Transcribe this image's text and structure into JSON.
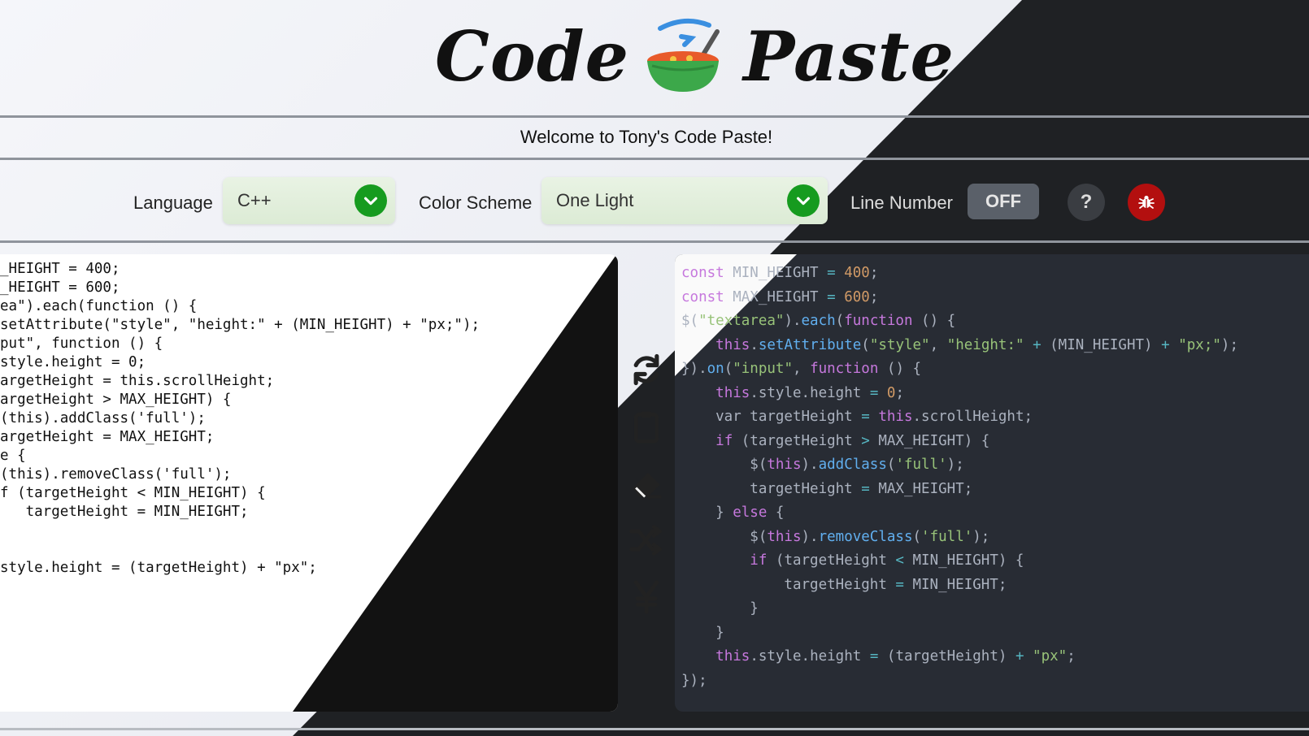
{
  "header": {
    "logo_left": "Code",
    "logo_right": "Paste",
    "welcome": "Welcome to Tony's Code Paste!"
  },
  "controls": {
    "language_label": "Language",
    "language_value": "C++",
    "scheme_label": "Color Scheme",
    "scheme_value": "One Light",
    "line_number_label": "Line Number",
    "line_number_state": "OFF",
    "help_label": "?"
  },
  "icons": [
    "bowl-logo-icon",
    "refresh-icon",
    "clipboard-icon",
    "eraser-icon",
    "shuffle-icon",
    "yen-icon",
    "chevron-down-icon",
    "bug-icon"
  ],
  "colors": {
    "dark_bg": "#1f2124",
    "code_bg": "#282c34",
    "accent_green": "#169b1f",
    "danger_red": "#b30f0f"
  },
  "code_left": [
    "_HEIGHT = 400;",
    "_HEIGHT = 600;",
    "ea\").each(function () {",
    "setAttribute(\"style\", \"height:\" + (MIN_HEIGHT) + \"px;\");",
    "put\", function () {",
    "style.height = 0;",
    "argetHeight = this.scrollHeight;",
    "argetHeight > MAX_HEIGHT) {",
    "(this).addClass('full');",
    "argetHeight = MAX_HEIGHT;",
    "e {",
    "(this).removeClass('full');",
    "f (targetHeight < MIN_HEIGHT) {",
    "   targetHeight = MIN_HEIGHT;",
    "",
    "",
    "style.height = (targetHeight) + \"px\";"
  ]
}
